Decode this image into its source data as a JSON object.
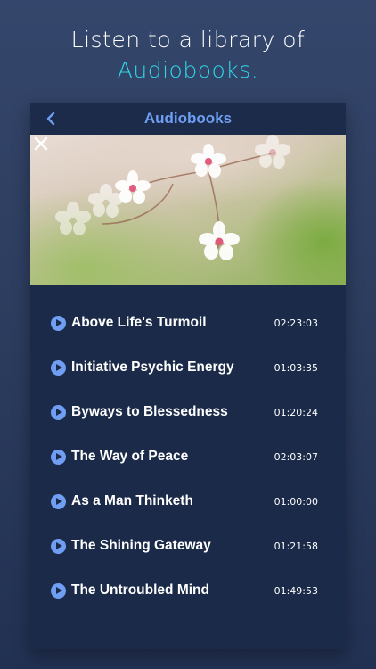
{
  "headline": {
    "line1": "Listen to a library of",
    "line2": "Audiobooks."
  },
  "header": {
    "title": "Audiobooks",
    "back_icon": "chevron-left-icon"
  },
  "hero": {
    "prev_icon": "chevron-left-icon",
    "next_icon": "chevron-right-icon"
  },
  "books": [
    {
      "title": "Above Life's Turmoil",
      "duration": "02:23:03"
    },
    {
      "title": "Initiative Psychic Energy",
      "duration": "01:03:35"
    },
    {
      "title": "Byways to Blessedness",
      "duration": "01:20:24"
    },
    {
      "title": "The Way of Peace",
      "duration": "02:03:07"
    },
    {
      "title": "As a Man Thinketh",
      "duration": "01:00:00"
    },
    {
      "title": "The Shining Gateway",
      "duration": "01:21:58"
    },
    {
      "title": "The Untroubled Mind",
      "duration": "01:49:53"
    }
  ],
  "colors": {
    "accent": "#6f9ef3",
    "highlight": "#2fd6e6",
    "card": "#1a2a48"
  }
}
